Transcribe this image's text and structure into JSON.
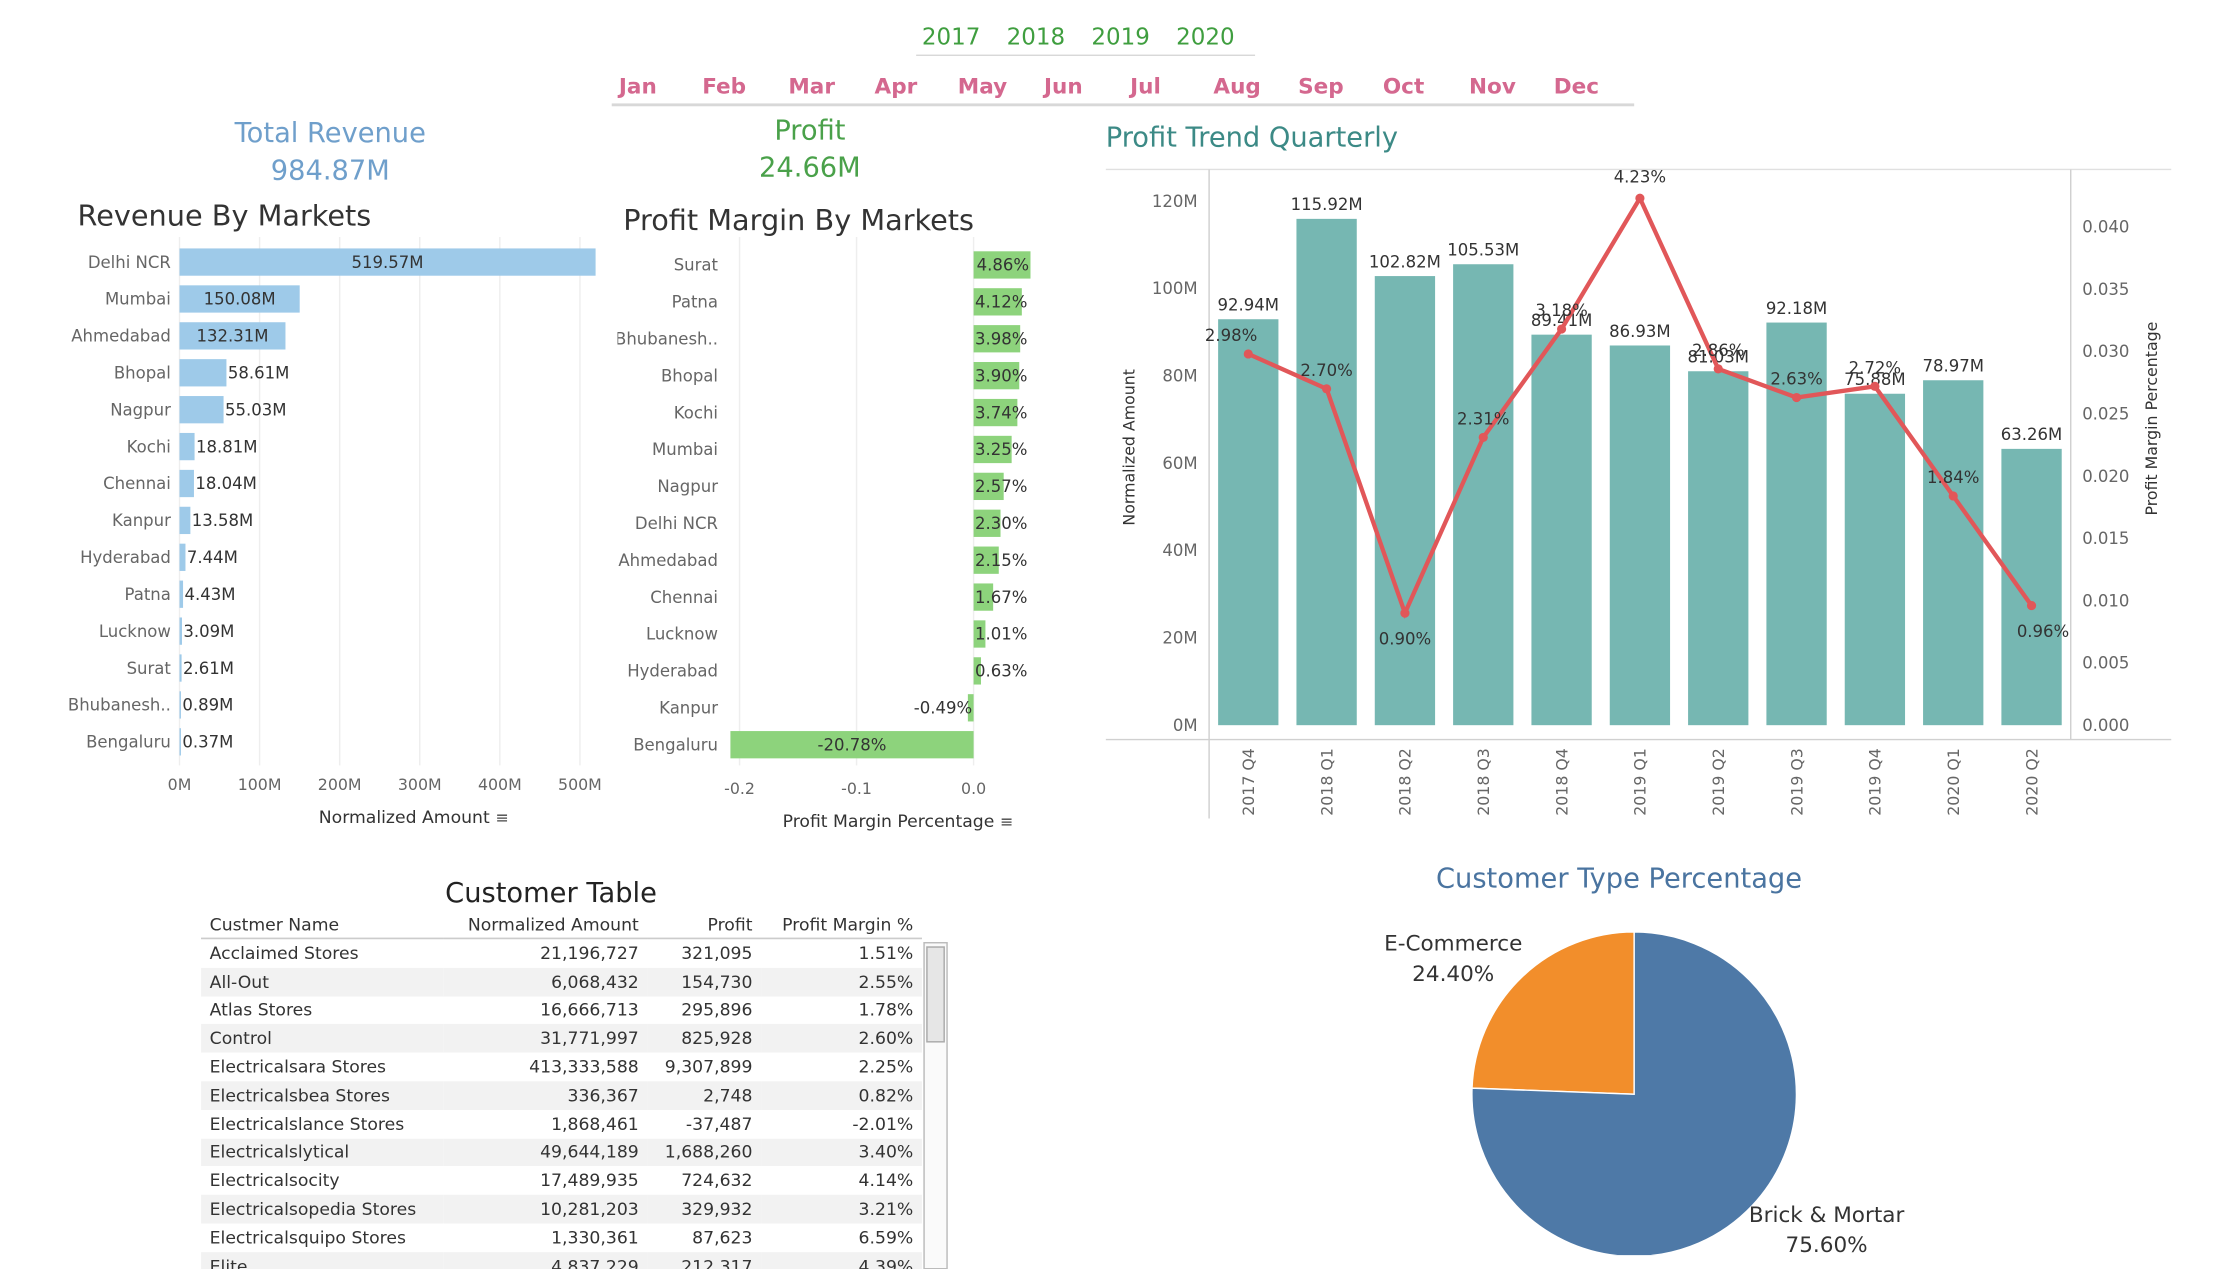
{
  "years": [
    "2017",
    "2018",
    "2019",
    "2020"
  ],
  "months": [
    "Jan",
    "Feb",
    "Mar",
    "Apr",
    "May",
    "Jun",
    "Jul",
    "Aug",
    "Sep",
    "Oct",
    "Nov",
    "Dec"
  ],
  "kpi": {
    "revenue_label": "Total Revenue",
    "revenue_value": "984.87M",
    "profit_label": "Profit",
    "profit_value": "24.66M"
  },
  "colors": {
    "revenue_bar": "#9ecae9",
    "margin_bar": "#8dd37c",
    "trend_bar": "#76b7b2",
    "trend_line": "#e15759",
    "pie_brick": "#4e79a7",
    "pie_ecom": "#f28e2b",
    "year_text": "#3f9e3f",
    "month_text": "#d4688f"
  },
  "customer_table": {
    "title": "Customer  Table",
    "columns": [
      "Custmer Name",
      "Normalized Amount",
      "Profit",
      "Profit Margin %"
    ],
    "rows": [
      [
        "Acclaimed Stores",
        "21,196,727",
        "321,095",
        "1.51%"
      ],
      [
        "All-Out",
        "6,068,432",
        "154,730",
        "2.55%"
      ],
      [
        "Atlas Stores",
        "16,666,713",
        "295,896",
        "1.78%"
      ],
      [
        "Control",
        "31,771,997",
        "825,928",
        "2.60%"
      ],
      [
        "Electricalsara Stores",
        "413,333,588",
        "9,307,899",
        "2.25%"
      ],
      [
        "Electricalsbea Stores",
        "336,367",
        "2,748",
        "0.82%"
      ],
      [
        "Electricalslance Stores",
        "1,868,461",
        "-37,487",
        "-2.01%"
      ],
      [
        "Electricalslytical",
        "49,644,189",
        "1,688,260",
        "3.40%"
      ],
      [
        "Electricalsocity",
        "17,489,935",
        "724,632",
        "4.14%"
      ],
      [
        "Electricalsopedia Stores",
        "10,281,203",
        "329,932",
        "3.21%"
      ],
      [
        "Electricalsquipo Stores",
        "1,330,361",
        "87,623",
        "6.59%"
      ],
      [
        "Elite",
        "4,837,229",
        "212,317",
        "4.39%"
      ]
    ]
  },
  "chart_data": [
    {
      "type": "bar",
      "orientation": "horizontal",
      "title": "Revenue By Markets",
      "xlabel": "Normalized Amount",
      "categories": [
        "Delhi NCR",
        "Mumbai",
        "Ahmedabad",
        "Bhopal",
        "Nagpur",
        "Kochi",
        "Chennai",
        "Kanpur",
        "Hyderabad",
        "Patna",
        "Lucknow",
        "Surat",
        "Bhubanesh..",
        "Bengaluru"
      ],
      "values": [
        519.57,
        150.08,
        132.31,
        58.61,
        55.03,
        18.81,
        18.04,
        13.58,
        7.44,
        4.43,
        3.09,
        2.61,
        0.89,
        0.37
      ],
      "labels": [
        "519.57M",
        "150.08M",
        "132.31M",
        "58.61M",
        "55.03M",
        "18.81M",
        "18.04M",
        "13.58M",
        "7.44M",
        "4.43M",
        "3.09M",
        "2.61M",
        "0.89M",
        "0.37M"
      ],
      "xticks": [
        "0M",
        "100M",
        "200M",
        "300M",
        "400M",
        "500M"
      ],
      "xlim": [
        0,
        520
      ]
    },
    {
      "type": "bar",
      "orientation": "horizontal",
      "title": "Profit Margin By Markets",
      "xlabel": "Profit Margin Percentage",
      "categories": [
        "Surat",
        "Patna",
        "Bhubanesh..",
        "Bhopal",
        "Kochi",
        "Mumbai",
        "Nagpur",
        "Delhi NCR",
        "Ahmedabad",
        "Chennai",
        "Lucknow",
        "Hyderabad",
        "Kanpur",
        "Bengaluru"
      ],
      "values": [
        4.86,
        4.12,
        3.98,
        3.9,
        3.74,
        3.25,
        2.57,
        2.3,
        2.15,
        1.67,
        1.01,
        0.63,
        -0.49,
        -20.78
      ],
      "labels": [
        "4.86%",
        "4.12%",
        "3.98%",
        "3.90%",
        "3.74%",
        "3.25%",
        "2.57%",
        "2.30%",
        "2.15%",
        "1.67%",
        "1.01%",
        "0.63%",
        "-0.49%",
        "-20.78%"
      ],
      "xticks": [
        "-0.2",
        "-0.1",
        "0.0"
      ],
      "xlim": [
        -0.2,
        0.05
      ]
    },
    {
      "type": "bar",
      "title": "Profit Trend Quarterly",
      "ylabel": "Normalized Amount",
      "y2label": "Profit Margin Percentage",
      "categories": [
        "2017 Q4",
        "2018 Q1",
        "2018 Q2",
        "2018 Q3",
        "2018 Q4",
        "2019 Q1",
        "2019 Q2",
        "2019 Q3",
        "2019 Q4",
        "2020 Q1",
        "2020 Q2"
      ],
      "series": [
        {
          "name": "Normalized Amount",
          "type": "bar",
          "values": [
            92.94,
            115.92,
            102.82,
            105.53,
            89.41,
            86.93,
            81.03,
            92.18,
            75.88,
            78.97,
            63.26
          ],
          "labels": [
            "92.94M",
            "115.92M",
            "102.82M",
            "105.53M",
            "89.41M",
            "86.93M",
            "81.03M",
            "92.18M",
            "75.88M",
            "78.97M",
            "63.26M"
          ]
        },
        {
          "name": "Profit Margin Percentage",
          "type": "line",
          "values": [
            2.98,
            2.7,
            0.9,
            2.31,
            3.18,
            4.23,
            2.86,
            2.63,
            2.72,
            1.84,
            0.96
          ],
          "labels": [
            "2.98%",
            "2.70%",
            "0.90%",
            "2.31%",
            "3.18%",
            "4.23%",
            "2.86%",
            "2.63%",
            "2.72%",
            "1.84%",
            "0.96%"
          ]
        }
      ],
      "yticks": [
        "0M",
        "20M",
        "40M",
        "60M",
        "80M",
        "100M",
        "120M"
      ],
      "ylim": [
        0,
        120
      ],
      "y2ticks": [
        "0.000",
        "0.005",
        "0.010",
        "0.015",
        "0.020",
        "0.025",
        "0.030",
        "0.035",
        "0.040"
      ],
      "y2lim": [
        0,
        0.04
      ]
    },
    {
      "type": "pie",
      "title": "Customer Type Percentage",
      "categories": [
        "E-Commerce",
        "Brick & Mortar"
      ],
      "values": [
        24.4,
        75.6
      ],
      "labels": [
        "24.40%",
        "75.60%"
      ]
    }
  ]
}
